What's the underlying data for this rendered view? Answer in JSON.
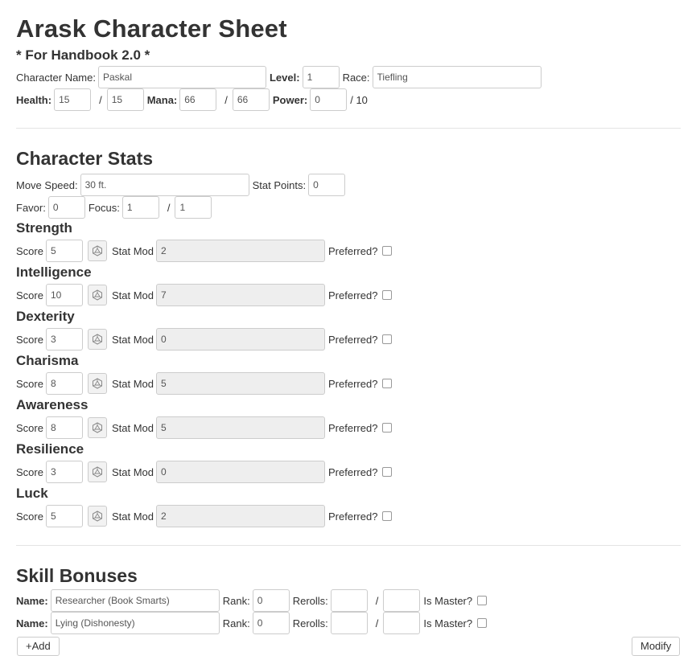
{
  "header": {
    "title": "Arask Character Sheet",
    "subtitle": "* For Handbook 2.0 *"
  },
  "basics": {
    "name_label": "Character Name:",
    "name": "Paskal",
    "level_label": "Level:",
    "level": "1",
    "race_label": "Race:",
    "race": "Tiefling",
    "health_label": "Health:",
    "health_current": "15",
    "health_max": "15",
    "mana_label": "Mana:",
    "mana_current": "66",
    "mana_max": "66",
    "power_label": "Power:",
    "power_current": "0",
    "power_max_text": "/ 10",
    "slash": "/"
  },
  "character_stats": {
    "heading": "Character Stats",
    "move_speed_label": "Move Speed:",
    "move_speed": "30 ft.",
    "stat_points_label": "Stat Points:",
    "stat_points": "0",
    "favor_label": "Favor:",
    "favor": "0",
    "focus_label": "Focus:",
    "focus_current": "1",
    "focus_max": "1",
    "score_label": "Score",
    "stat_mod_label": "Stat Mod",
    "preferred_label": "Preferred?",
    "dice_icon": "d20-dice-icon",
    "stats": [
      {
        "name": "Strength",
        "score": "5",
        "mod": "2",
        "preferred": false
      },
      {
        "name": "Intelligence",
        "score": "10",
        "mod": "7",
        "preferred": false
      },
      {
        "name": "Dexterity",
        "score": "3",
        "mod": "0",
        "preferred": false
      },
      {
        "name": "Charisma",
        "score": "8",
        "mod": "5",
        "preferred": false
      },
      {
        "name": "Awareness",
        "score": "8",
        "mod": "5",
        "preferred": false
      },
      {
        "name": "Resilience",
        "score": "3",
        "mod": "0",
        "preferred": false
      },
      {
        "name": "Luck",
        "score": "5",
        "mod": "2",
        "preferred": false
      }
    ]
  },
  "skill_bonuses": {
    "heading": "Skill Bonuses",
    "name_label": "Name:",
    "rank_label": "Rank:",
    "rerolls_label": "Rerolls:",
    "is_master_label": "Is Master?",
    "skills": [
      {
        "name": "Researcher (Book Smarts)",
        "rank": "0",
        "rerolls_current": "",
        "rerolls_max": "",
        "is_master": false
      },
      {
        "name": "Lying (Dishonesty)",
        "rank": "0",
        "rerolls_current": "",
        "rerolls_max": "",
        "is_master": false
      }
    ],
    "add_label": "+Add",
    "modify_label": "Modify"
  }
}
